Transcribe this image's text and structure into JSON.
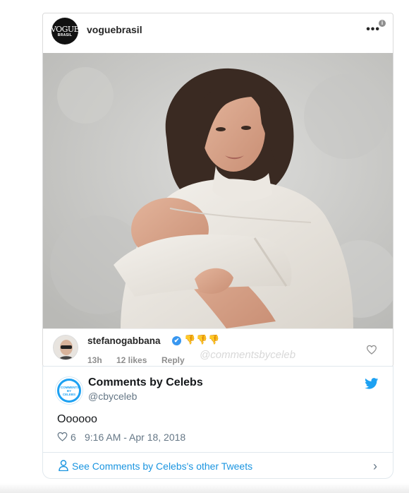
{
  "instagram": {
    "username": "voguebrasil",
    "avatar_logo_top": "VOGUE",
    "avatar_logo_bottom": "BRASIL",
    "more_icon": "more-horizontal-icon",
    "info_icon": "info-icon",
    "photo_icon": "portrait-photo",
    "comment": {
      "username": "stefanogabbana",
      "verified_glyph": "✔",
      "emojis": "👎👎👎",
      "watermark": "@commentsbyceleb",
      "time": "13h",
      "likes": "12 likes",
      "reply": "Reply",
      "like_icon": "heart-outline-icon"
    }
  },
  "tweet": {
    "name": "Comments by Celebs",
    "handle": "@cbyceleb",
    "avatar_text": "COMMENTS BY CELEBS",
    "text": "Oooooo",
    "like_count": "6",
    "timestamp": "9:16 AM - Apr 18, 2018",
    "more_tweets_link": "See Comments by Celebs's other Tweets",
    "brand_color": "#1da1f2",
    "link_color": "#1b95e0"
  }
}
